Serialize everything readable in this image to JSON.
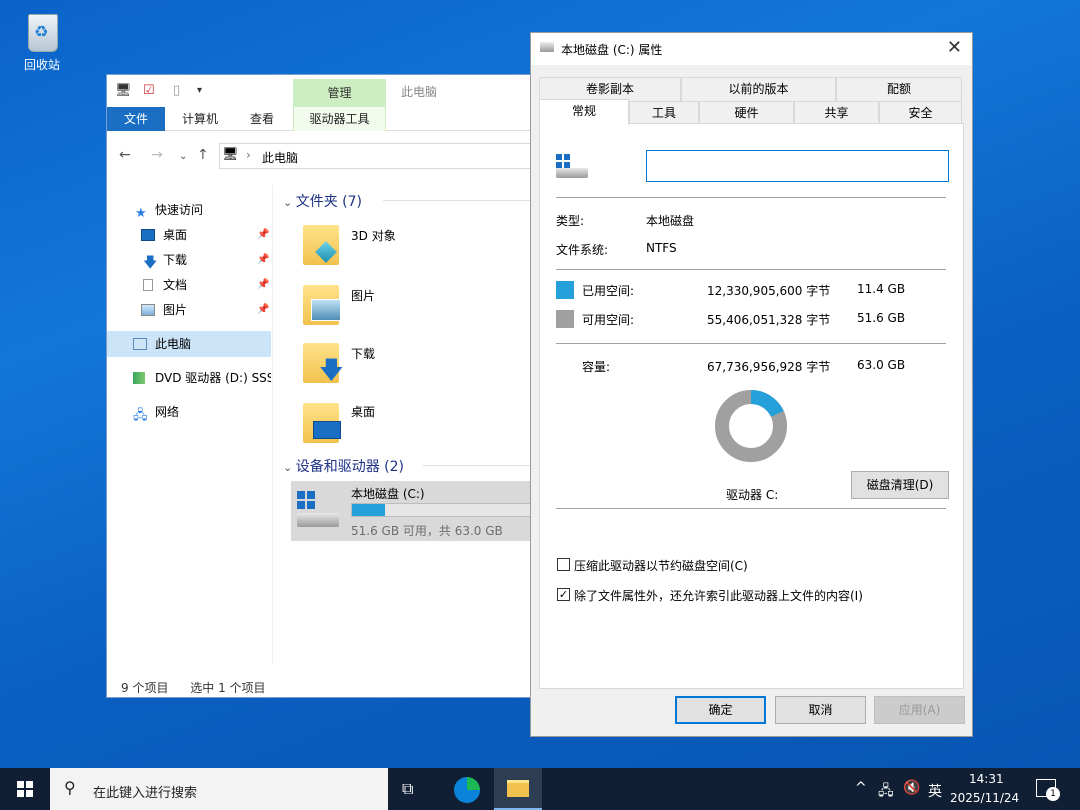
{
  "desktop": {
    "recycle_bin_label": "回收站"
  },
  "explorer": {
    "context_tab_label": "管理",
    "context_title": "此电脑",
    "ribbon_tabs": [
      "文件",
      "计算机",
      "查看",
      "驱动器工具"
    ],
    "address": "此电脑",
    "nav": [
      {
        "label": "快速访问",
        "icon": "star-icon"
      },
      {
        "label": "桌面",
        "icon": "desktop-icon",
        "pinned": true
      },
      {
        "label": "下载",
        "icon": "download-icon",
        "pinned": true
      },
      {
        "label": "文档",
        "icon": "document-icon",
        "pinned": true
      },
      {
        "label": "图片",
        "icon": "picture-icon",
        "pinned": true
      },
      {
        "label": "此电脑",
        "icon": "pc-icon",
        "selected": true
      },
      {
        "label": "DVD 驱动器 (D:) SSS",
        "icon": "dvd-icon"
      },
      {
        "label": "网络",
        "icon": "network-icon"
      }
    ],
    "folders_group": "文件夹 (7)",
    "folders": [
      "3D 对象",
      "图片",
      "下载",
      "桌面"
    ],
    "devices_group": "设备和驱动器 (2)",
    "drive_name": "本地磁盘 (C:)",
    "drive_free_text": "51.6 GB 可用，共 63.0 GB",
    "drive_used_fraction": 0.181,
    "status_items": "9 个项目",
    "status_selected": "选中 1 个项目"
  },
  "dialog": {
    "title": "本地磁盘 (C:) 属性",
    "tabs_top": [
      "卷影副本",
      "以前的版本",
      "配额"
    ],
    "tabs_bottom": [
      "常规",
      "工具",
      "硬件",
      "共享",
      "安全"
    ],
    "name_value": "",
    "type_label": "类型:",
    "type_value": "本地磁盘",
    "fs_label": "文件系统:",
    "fs_value": "NTFS",
    "used_label": "已用空间:",
    "used_bytes": "12,330,905,600 字节",
    "used_gb": "11.4 GB",
    "free_label": "可用空间:",
    "free_bytes": "55,406,051,328 字节",
    "free_gb": "51.6 GB",
    "cap_label": "容量:",
    "cap_bytes": "67,736,956,928 字节",
    "cap_gb": "63.0 GB",
    "drive_label": "驱动器 C:",
    "cleanup_button": "磁盘清理(D)",
    "compress_label": "压缩此驱动器以节约磁盘空间(C)",
    "index_label": "除了文件属性外，还允许索引此驱动器上文件的内容(I)",
    "ok": "确定",
    "cancel": "取消",
    "apply": "应用(A)",
    "used_color": "#26a0da",
    "free_color": "#a0a0a0"
  },
  "taskbar": {
    "search_placeholder": "在此键入进行搜索",
    "ime": "英",
    "time": "14:31",
    "date": "2025/11/24",
    "notifications": "1"
  }
}
